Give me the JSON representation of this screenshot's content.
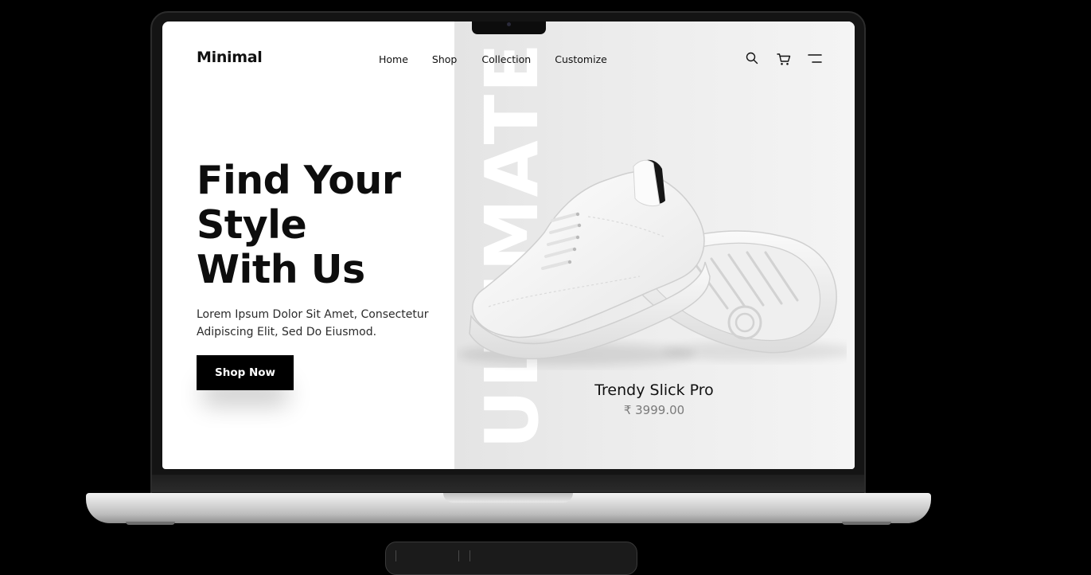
{
  "brand": {
    "name": "Minimal"
  },
  "nav": {
    "items": [
      {
        "label": "Home"
      },
      {
        "label": "Shop"
      },
      {
        "label": "Collection"
      },
      {
        "label": "Customize"
      }
    ]
  },
  "header_icons": [
    "search-icon",
    "cart-icon",
    "menu-icon"
  ],
  "hero": {
    "title_lines": [
      "Find Your",
      "Style",
      "With Us"
    ],
    "description": "Lorem Ipsum Dolor Sit Amet, Consectetur Adipiscing Elit, Sed Do Eiusmod.",
    "cta_label": "Shop Now"
  },
  "feature": {
    "vertical_word": "ULTIMATE",
    "product_name": "Trendy Slick Pro",
    "product_price": "₹ 3999.00"
  },
  "colors": {
    "primary": "#000000",
    "background": "#ffffff",
    "panel": "#ececec",
    "price": "#7a7a7a"
  }
}
